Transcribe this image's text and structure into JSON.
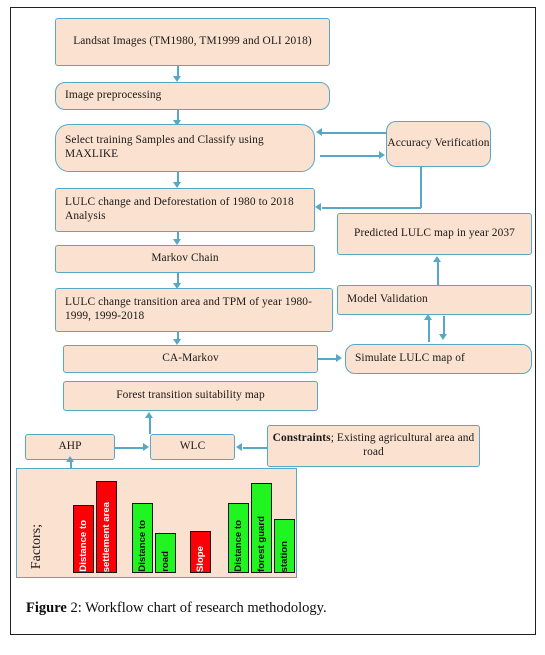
{
  "figure": {
    "caption_label": "Figure",
    "caption_number": " 2:",
    "caption_text": " Workflow chart of research methodology."
  },
  "colors": {
    "node_fill": "#fbe2d0",
    "node_border": "#57a8c7",
    "connector": "#57a8c7",
    "bar_red": "#fb0007",
    "bar_green": "#21f521",
    "frame": "#231f20",
    "text": "#1a1718"
  },
  "flow": {
    "nodes": [
      {
        "id": "landsat-images",
        "label": "Landsat Images (TM1980, TM1999 and OLI 2018)"
      },
      {
        "id": "image-preprocessing",
        "label": "Image preprocessing"
      },
      {
        "id": "select-training",
        "label": "Select training Samples and Classify using MAXLIKE"
      },
      {
        "id": "accuracy-verification",
        "label": "Accuracy Verification"
      },
      {
        "id": "lulc-change-defor",
        "label": "LULC change and Deforestation of 1980 to 2018 Analysis"
      },
      {
        "id": "predicted-lulc-map",
        "label": "Predicted LULC map in year 2037"
      },
      {
        "id": "markov-chain",
        "label": "Markov Chain"
      },
      {
        "id": "lulc-transition-tpm",
        "label": "LULC change transition area and TPM of year 1980-1999, 1999-2018"
      },
      {
        "id": "model-validation",
        "label": "Model Validation"
      },
      {
        "id": "ca-markov",
        "label": "CA-Markov"
      },
      {
        "id": "simulate-lulc-map",
        "label": "Simulate LULC map of"
      },
      {
        "id": "forest-suitability",
        "label": "Forest transition suitability map"
      },
      {
        "id": "ahp",
        "label": "AHP"
      },
      {
        "id": "wlc",
        "label": "WLC"
      },
      {
        "id": "constraints-bold",
        "label": "Constraints"
      },
      {
        "id": "constraints-rest",
        "label": "; Existing agricultural area and road"
      }
    ]
  },
  "factors": {
    "panel_label": "Factors;",
    "bars": [
      {
        "id": "distance-to-settlement-area",
        "label": "Distance to settlement area",
        "line1": "Distance to",
        "line2": "settlement area",
        "color_1": "#fb0007",
        "color_2": "#fb0007",
        "height_1": 68,
        "height_2": 92
      },
      {
        "id": "distance-to-road",
        "label": "Distance to road",
        "line1": "Distance to",
        "line2": "road",
        "color_1": "#21f521",
        "color_2": "#21f521",
        "height_1": 70,
        "height_2": 40
      },
      {
        "id": "slope",
        "label": "Slope",
        "line1": "Slope",
        "line2": "",
        "color_1": "#fb0007",
        "color_2": "",
        "height_1": 42,
        "height_2": 0
      },
      {
        "id": "distance-to-forest-guard-station",
        "label": "Distance to forest guard station",
        "line1": "Distance to",
        "line2": "forest  guard",
        "line3": "station",
        "color_1": "#21f521",
        "color_2": "#21f521",
        "color_3": "#21f521",
        "height_1": 70,
        "height_2": 90,
        "height_3": 54
      }
    ]
  }
}
